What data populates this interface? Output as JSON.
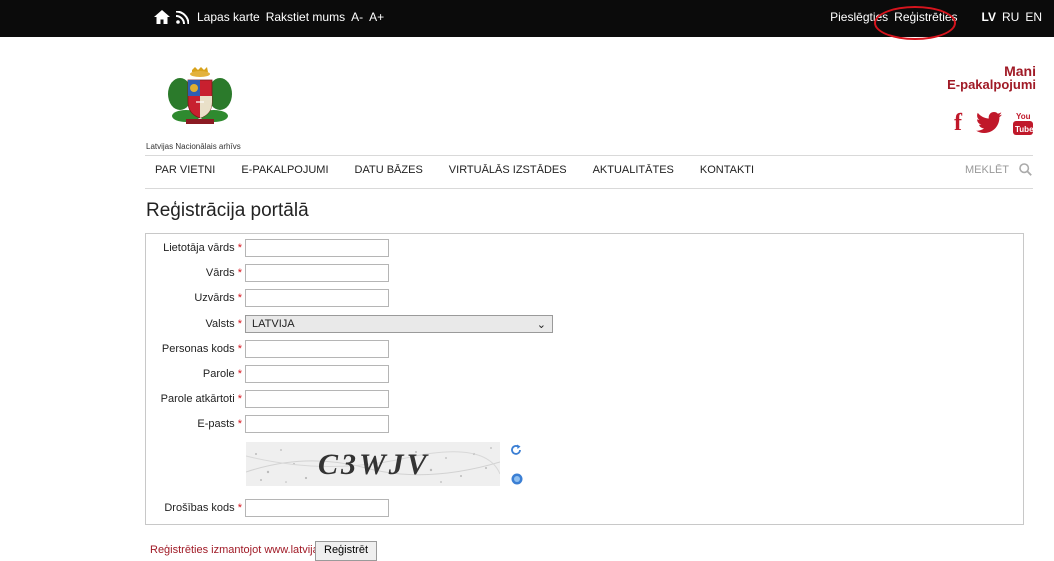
{
  "topbar": {
    "home_icon": "home-icon",
    "rss_icon": "rss-icon",
    "links": [
      "Lapas karte",
      "Rakstiet mums",
      "A-",
      "A+"
    ],
    "login": "Pieslēgties",
    "register": "Reģistrēties",
    "languages": [
      "LV",
      "RU",
      "EN"
    ],
    "active_language": "LV"
  },
  "header": {
    "logo_caption": "Latvijas Nacionālais arhīvs",
    "mani_line1": "Mani",
    "mani_line2": "E-pakalpojumi",
    "social": {
      "facebook": "f",
      "twitter_icon": "twitter-icon",
      "youtube_icon": "youtube-icon"
    },
    "brand_color": "#a01a26"
  },
  "nav": {
    "items": [
      "PAR VIETNI",
      "E-PAKALPOJUMI",
      "DATU BĀZES",
      "VIRTUĀLĀS IZSTĀDES",
      "AKTUALITĀTES",
      "KONTAKTI"
    ],
    "search_label": "MEKLĒT"
  },
  "page_title": "Reģistrācija portālā",
  "form": {
    "required_mark": "*",
    "username_label": "Lietotāja vārds",
    "firstname_label": "Vārds",
    "lastname_label": "Uzvārds",
    "country_label": "Valsts",
    "country_value": "LATVIJA",
    "personal_code_label": "Personas kods",
    "password_label": "Parole",
    "password_repeat_label": "Parole atkārtoti",
    "email_label": "E-pasts",
    "captcha_text": "C3WJV",
    "security_code_label": "Drošības kods"
  },
  "footer": {
    "latvija_link": "Reģistrēties izmantojot www.latvija.lv",
    "submit_label": "Reģistrēt"
  }
}
